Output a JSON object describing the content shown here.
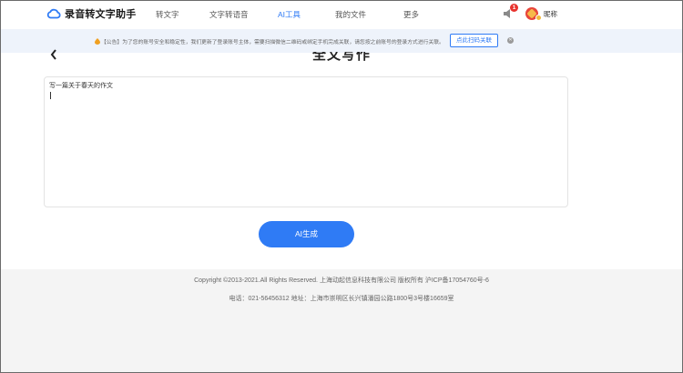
{
  "brand": {
    "name": "录音转文字助手",
    "logo_icon": "cloud-icon",
    "accent": "#2f7bf5"
  },
  "nav": {
    "items": [
      {
        "label": "转文字",
        "active": false
      },
      {
        "label": "文字转语音",
        "active": false
      },
      {
        "label": "AI工具",
        "active": true
      },
      {
        "label": "我的文件",
        "active": false
      },
      {
        "label": "更多",
        "active": false
      }
    ]
  },
  "user": {
    "notification_count": "1",
    "nickname": "昵称",
    "notification_icon": "bell-icon",
    "avatar_icon": "avatar-icon"
  },
  "notice": {
    "text": "【公告】为了您的账号安全和稳定性，我们更新了登录账号主体，需要扫描微信二维码或绑定手机完成关联，请您按之前账号的登录方式进行关联。",
    "action_label": "点此扫码关联",
    "close_icon": "close-icon"
  },
  "main": {
    "title": "全文写作",
    "back_icon": "chevron-left-icon",
    "prompt_value": "写一篇关于春天的作文",
    "generate_label": "AI生成"
  },
  "footer": {
    "copyright": "Copyright ©2013-2021.All Rights Reserved. 上海动起信息科技有限公司 版权所有 沪ICP备17054760号-6",
    "contact": "电话：021-56456312 地址：上海市崇明区长兴镇潘园公路1800号3号楼16659室"
  }
}
